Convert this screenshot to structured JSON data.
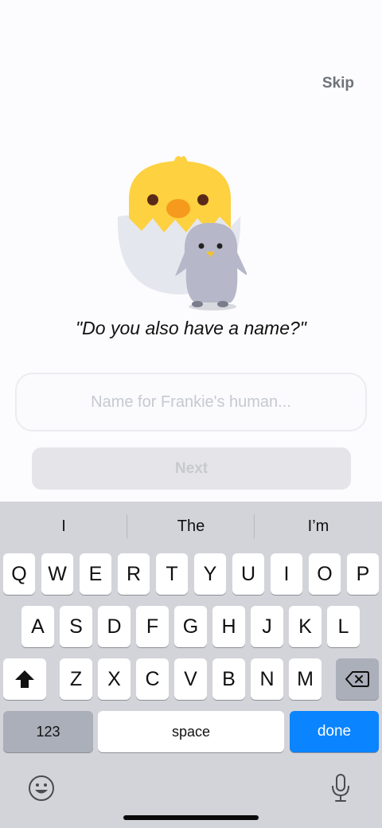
{
  "header": {
    "skip_label": "Skip"
  },
  "onboarding": {
    "prompt": "\"Do you also have a name?\"",
    "name_placeholder": "Name for Frankie's human...",
    "name_value": "",
    "next_label": "Next"
  },
  "keyboard": {
    "suggestions": [
      "I",
      "The",
      "I’m"
    ],
    "row1": [
      "Q",
      "W",
      "E",
      "R",
      "T",
      "Y",
      "U",
      "I",
      "O",
      "P"
    ],
    "row2": [
      "A",
      "S",
      "D",
      "F",
      "G",
      "H",
      "J",
      "K",
      "L"
    ],
    "row3": [
      "Z",
      "X",
      "C",
      "V",
      "B",
      "N",
      "M"
    ],
    "numbers_label": "123",
    "space_label": "space",
    "done_label": "done",
    "accent_color": "#0a84ff"
  }
}
